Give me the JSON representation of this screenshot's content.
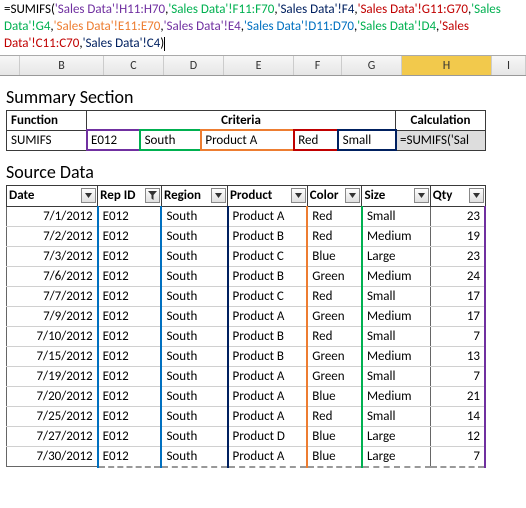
{
  "formula_parts": {
    "func": "=SUMIFS(",
    "a1": "'Sales Data'!H11:H70",
    "a2": "'Sales Data'!F11:F70",
    "a3": "'Sales Data'!F4",
    "a4": "'Sales Data'!G11:G70",
    "a5": "'Sales Data'!G4",
    "a6": "'Sales Data'!E11:E70",
    "a7": "'Sales Data'!E4",
    "a8": "'Sales Data'!D11:D70",
    "a9": "'Sales Data'!D4",
    "a10": "'Sales Data'!C11:C70",
    "a11": "'Sales Data'!C4",
    "close": ")"
  },
  "col_headers": [
    "B",
    "C",
    "D",
    "E",
    "F",
    "G",
    "H",
    "I"
  ],
  "summary": {
    "title": "Summary Section",
    "headers": {
      "function": "Function",
      "criteria": "Criteria",
      "calculation": "Calculation"
    },
    "function": "SUMIFS",
    "criteria": [
      "E012",
      "South",
      "Product A",
      "Red",
      "Small"
    ],
    "calc_display": "=SUMIFS('Sal"
  },
  "source": {
    "title": "Source Data",
    "headers": [
      "Date",
      "Rep ID",
      "Region",
      "Product",
      "Color",
      "Size",
      "Qty"
    ],
    "rows": [
      {
        "date": "7/1/2012",
        "rep": "E012",
        "region": "South",
        "product": "Product A",
        "color": "Red",
        "size": "Small",
        "qty": 23
      },
      {
        "date": "7/2/2012",
        "rep": "E012",
        "region": "South",
        "product": "Product B",
        "color": "Red",
        "size": "Medium",
        "qty": 19
      },
      {
        "date": "7/3/2012",
        "rep": "E012",
        "region": "South",
        "product": "Product C",
        "color": "Blue",
        "size": "Large",
        "qty": 23
      },
      {
        "date": "7/6/2012",
        "rep": "E012",
        "region": "South",
        "product": "Product B",
        "color": "Green",
        "size": "Medium",
        "qty": 24
      },
      {
        "date": "7/7/2012",
        "rep": "E012",
        "region": "South",
        "product": "Product C",
        "color": "Red",
        "size": "Small",
        "qty": 17
      },
      {
        "date": "7/9/2012",
        "rep": "E012",
        "region": "South",
        "product": "Product A",
        "color": "Green",
        "size": "Medium",
        "qty": 17
      },
      {
        "date": "7/10/2012",
        "rep": "E012",
        "region": "South",
        "product": "Product B",
        "color": "Red",
        "size": "Small",
        "qty": 7
      },
      {
        "date": "7/15/2012",
        "rep": "E012",
        "region": "South",
        "product": "Product B",
        "color": "Green",
        "size": "Medium",
        "qty": 13
      },
      {
        "date": "7/19/2012",
        "rep": "E012",
        "region": "South",
        "product": "Product A",
        "color": "Green",
        "size": "Small",
        "qty": 7
      },
      {
        "date": "7/20/2012",
        "rep": "E012",
        "region": "South",
        "product": "Product A",
        "color": "Blue",
        "size": "Medium",
        "qty": 21
      },
      {
        "date": "7/25/2012",
        "rep": "E012",
        "region": "South",
        "product": "Product A",
        "color": "Red",
        "size": "Small",
        "qty": 14
      },
      {
        "date": "7/27/2012",
        "rep": "E012",
        "region": "South",
        "product": "Product D",
        "color": "Blue",
        "size": "Large",
        "qty": 12
      },
      {
        "date": "7/30/2012",
        "rep": "E012",
        "region": "South",
        "product": "Product A",
        "color": "Blue",
        "size": "Large",
        "qty": 7
      }
    ]
  }
}
